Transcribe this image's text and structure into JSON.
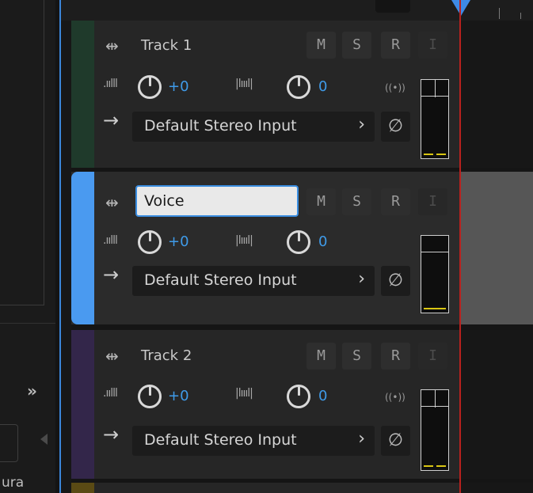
{
  "left_panel": {
    "expand_label": "»",
    "bottom_label": "ura"
  },
  "tracks": [
    {
      "name": "Track 1",
      "color": "#1f3a2b",
      "buttons": {
        "mute": "M",
        "solo": "S",
        "record": "R",
        "input_monitor": "I"
      },
      "volume": "+0",
      "pan": "0",
      "input": "Default Stereo Input",
      "editing": false
    },
    {
      "name": "Voice",
      "color": "#4a9af0",
      "buttons": {
        "mute": "M",
        "solo": "S",
        "record": "R",
        "input_monitor": "I"
      },
      "volume": "+0",
      "pan": "0",
      "input": "Default Stereo Input",
      "editing": true
    },
    {
      "name": "Track 2",
      "color": "#33264a",
      "buttons": {
        "mute": "M",
        "solo": "S",
        "record": "R",
        "input_monitor": "I"
      },
      "volume": "+0",
      "pan": "0",
      "input": "Default Stereo Input",
      "editing": false
    }
  ],
  "icons": {
    "track_type": "waveform-arrows-icon",
    "volume": "volume-bars-icon",
    "pan": "pan-bars-icon",
    "monitor": "broadcast-icon",
    "input_arrow": "arrow-right-icon",
    "phase": "phase-invert-icon"
  },
  "colors": {
    "accent": "#3f9be9",
    "playhead": "#b8211e",
    "selection": "#4a9af0",
    "meter": "#d9c613"
  }
}
